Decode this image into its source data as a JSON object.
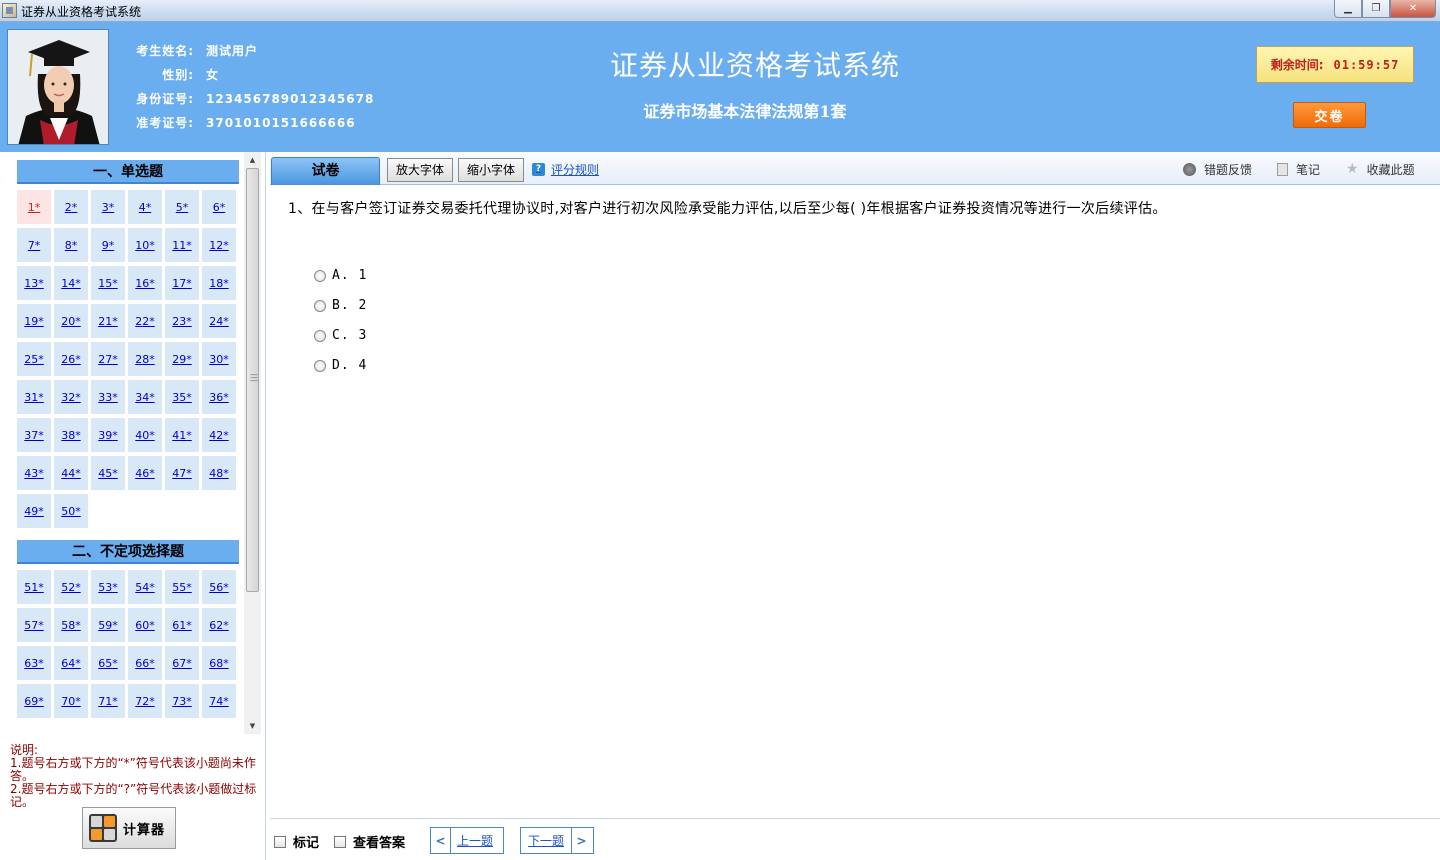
{
  "window": {
    "title": "证券从业资格考试系统",
    "min_label": "▁",
    "max_label": "❐",
    "close_label": "✕"
  },
  "candidate": {
    "name_label": "考生姓名:",
    "name": "测试用户",
    "gender_label": "性别:",
    "gender": "女",
    "id_label": "身份证号:",
    "id_number": "123456789012345678",
    "ticket_label": "准考证号:",
    "ticket_number": "3701010151666666"
  },
  "header": {
    "system_title": "证券从业资格考试系统",
    "paper_title": "证券市场基本法律法规第1套"
  },
  "timer": {
    "label": "剩余时间:",
    "value": "01:59:57"
  },
  "submit_label": "交卷",
  "sections": [
    {
      "title": "一、单选题",
      "start": 1,
      "count": 50,
      "current": 1
    },
    {
      "title": "二、不定项选择题",
      "start": 51,
      "count": 24
    }
  ],
  "notes": {
    "heading": "说明:",
    "line1": "1.题号右方或下方的“*”符号代表该小题尚未作答。",
    "line2": "2.题号右方或下方的“?”符号代表该小题做过标记。"
  },
  "calculator_label": "计算器",
  "toolbar": {
    "tab_paper": "试卷",
    "zoom_in": "放大字体",
    "zoom_out": "缩小字体",
    "score_rules": "评分规则",
    "error_feedback": "错题反馈",
    "notes": "笔记",
    "favorite": "收藏此题"
  },
  "question": {
    "text": "1、在与客户签订证券交易委托代理协议时,对客户进行初次风险承受能力评估,以后至少每(   )年根据客户证券投资情况等进行一次后续评估。",
    "options": [
      "A. 1",
      "B. 2",
      "C. 3",
      "D. 4"
    ]
  },
  "bottom": {
    "mark_label": "标记",
    "show_answer_label": "查看答案",
    "prev_label": "上一题",
    "next_label": "下一题"
  }
}
